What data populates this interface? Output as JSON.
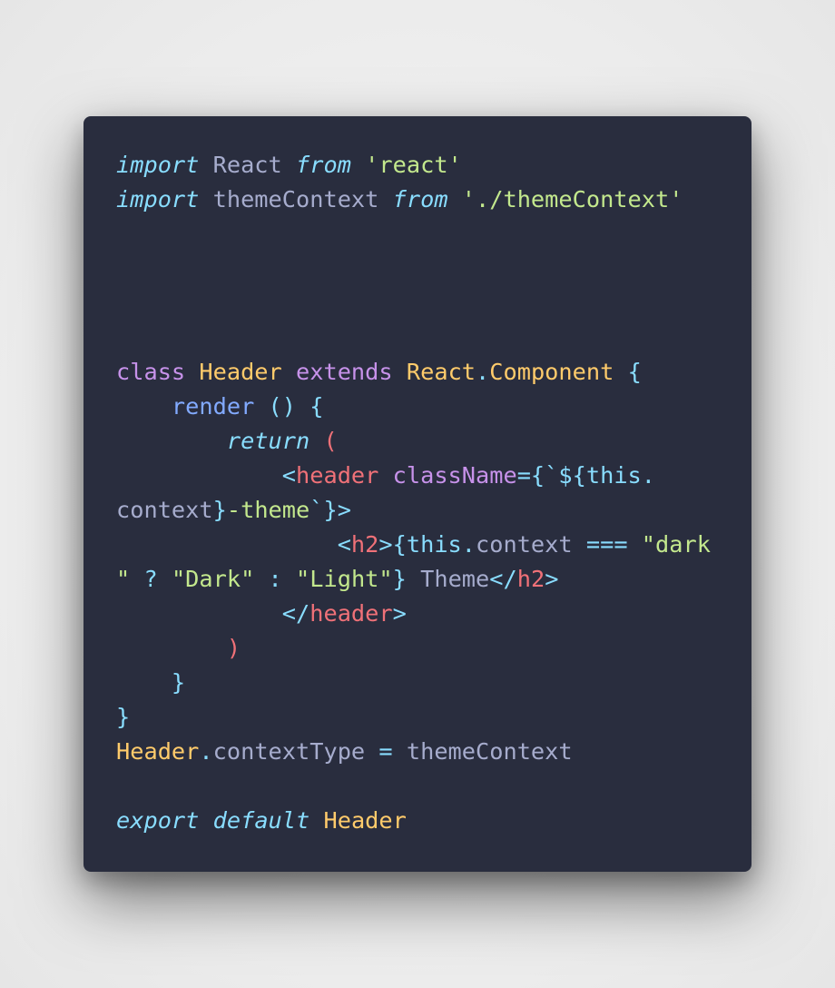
{
  "code_lines": [
    [
      {
        "t": "import",
        "c": "kw-italic"
      },
      {
        "t": " React ",
        "c": "ident"
      },
      {
        "t": "from",
        "c": "kw-italic"
      },
      {
        "t": " ",
        "c": "ident"
      },
      {
        "t": "'react'",
        "c": "string"
      }
    ],
    [
      {
        "t": "import",
        "c": "kw-italic"
      },
      {
        "t": " themeContext ",
        "c": "ident"
      },
      {
        "t": "from",
        "c": "kw-italic"
      },
      {
        "t": " ",
        "c": "ident"
      },
      {
        "t": "'./themeContext'",
        "c": "string"
      }
    ],
    [],
    [],
    [],
    [],
    [
      {
        "t": "class",
        "c": "keyword"
      },
      {
        "t": " ",
        "c": "ident"
      },
      {
        "t": "Header",
        "c": "classname"
      },
      {
        "t": " ",
        "c": "ident"
      },
      {
        "t": "extends",
        "c": "keyword"
      },
      {
        "t": " ",
        "c": "ident"
      },
      {
        "t": "React",
        "c": "classname"
      },
      {
        "t": ".",
        "c": "punct"
      },
      {
        "t": "Component",
        "c": "classname"
      },
      {
        "t": " {",
        "c": "punct"
      }
    ],
    [
      {
        "t": "    ",
        "c": "ident"
      },
      {
        "t": "render",
        "c": "func"
      },
      {
        "t": " () {",
        "c": "punct"
      }
    ],
    [
      {
        "t": "        ",
        "c": "ident"
      },
      {
        "t": "return",
        "c": "kw-italic"
      },
      {
        "t": " (",
        "c": "paren-red"
      }
    ],
    [
      {
        "t": "            ",
        "c": "ident"
      },
      {
        "t": "<",
        "c": "punct"
      },
      {
        "t": "header",
        "c": "tag"
      },
      {
        "t": " ",
        "c": "ident"
      },
      {
        "t": "className",
        "c": "attr"
      },
      {
        "t": "={`${",
        "c": "punct"
      },
      {
        "t": "this",
        "c": "this"
      },
      {
        "t": ".",
        "c": "punct"
      }
    ],
    [
      {
        "t": "context",
        "c": "ident"
      },
      {
        "t": "}",
        "c": "punct"
      },
      {
        "t": "-theme",
        "c": "string"
      },
      {
        "t": "`}>",
        "c": "punct"
      }
    ],
    [
      {
        "t": "                ",
        "c": "ident"
      },
      {
        "t": "<",
        "c": "punct"
      },
      {
        "t": "h2",
        "c": "tag"
      },
      {
        "t": ">{",
        "c": "punct"
      },
      {
        "t": "this",
        "c": "this"
      },
      {
        "t": ".",
        "c": "punct"
      },
      {
        "t": "context",
        "c": "ident"
      },
      {
        "t": " === ",
        "c": "punct"
      },
      {
        "t": "\"dark",
        "c": "string"
      }
    ],
    [
      {
        "t": "\"",
        "c": "string"
      },
      {
        "t": " ? ",
        "c": "punct"
      },
      {
        "t": "\"Dark\"",
        "c": "string"
      },
      {
        "t": " : ",
        "c": "punct"
      },
      {
        "t": "\"Light\"",
        "c": "string"
      },
      {
        "t": "}",
        "c": "punct"
      },
      {
        "t": " Theme",
        "c": "ident"
      },
      {
        "t": "</",
        "c": "punct"
      },
      {
        "t": "h2",
        "c": "tag"
      },
      {
        "t": ">",
        "c": "punct"
      }
    ],
    [
      {
        "t": "            ",
        "c": "ident"
      },
      {
        "t": "</",
        "c": "punct"
      },
      {
        "t": "header",
        "c": "tag"
      },
      {
        "t": ">",
        "c": "punct"
      }
    ],
    [
      {
        "t": "        ",
        "c": "ident"
      },
      {
        "t": ")",
        "c": "paren-red"
      }
    ],
    [
      {
        "t": "    ",
        "c": "ident"
      },
      {
        "t": "}",
        "c": "punct"
      }
    ],
    [
      {
        "t": "}",
        "c": "punct"
      }
    ],
    [
      {
        "t": "Header",
        "c": "classname"
      },
      {
        "t": ".",
        "c": "punct"
      },
      {
        "t": "contextType",
        "c": "ident"
      },
      {
        "t": " = ",
        "c": "punct"
      },
      {
        "t": "themeContext",
        "c": "ident"
      }
    ],
    [],
    [
      {
        "t": "export",
        "c": "kw-italic"
      },
      {
        "t": " ",
        "c": "ident"
      },
      {
        "t": "default",
        "c": "kw-italic"
      },
      {
        "t": " ",
        "c": "ident"
      },
      {
        "t": "Header",
        "c": "classname"
      }
    ]
  ],
  "colors": {
    "background": "#ececec",
    "editor_background": "#292d3e",
    "default_text": "#a6accd",
    "keyword_italic": "#89ddff",
    "string": "#c3e88d",
    "keyword": "#c792ea",
    "class_name": "#ffcb6b",
    "function": "#82aaff",
    "tag": "#f07178"
  }
}
